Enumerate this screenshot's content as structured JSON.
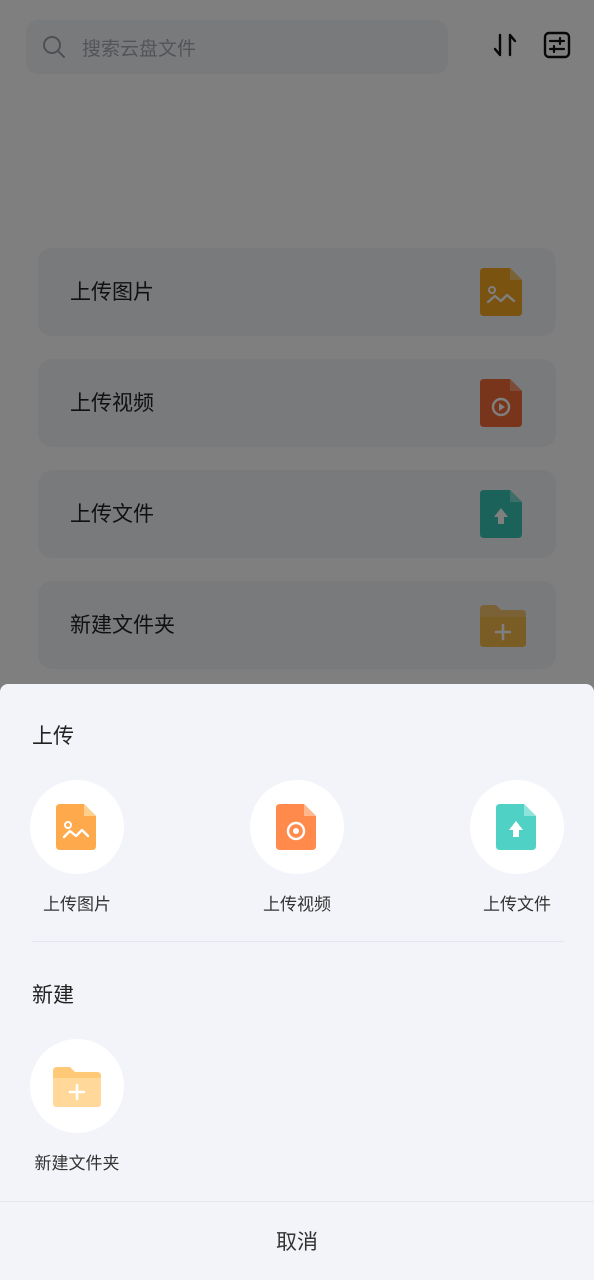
{
  "search": {
    "placeholder": "搜索云盘文件",
    "search_icon": "search-icon"
  },
  "toolbar": {
    "sort_icon": "sort-arrows-icon",
    "filter_icon": "filter-sliders-icon"
  },
  "options": [
    {
      "label": "上传图片",
      "icon": "image-file-icon",
      "color": "#f5a623"
    },
    {
      "label": "上传视频",
      "icon": "video-file-icon",
      "color": "#f26b36"
    },
    {
      "label": "上传文件",
      "icon": "upload-file-icon",
      "color": "#36c7b5"
    },
    {
      "label": "新建文件夹",
      "icon": "folder-plus-icon",
      "color": "#f7c46c"
    }
  ],
  "sheet": {
    "upload_title": "上传",
    "upload_actions": [
      {
        "label": "上传图片",
        "icon": "image-file-icon",
        "color": "#ffa94d"
      },
      {
        "label": "上传视频",
        "icon": "video-file-icon",
        "color": "#ff8a4c"
      },
      {
        "label": "上传文件",
        "icon": "upload-file-icon",
        "color": "#4fd1c5"
      }
    ],
    "new_title": "新建",
    "new_actions": [
      {
        "label": "新建文件夹",
        "icon": "folder-plus-icon",
        "color": "#ffc978"
      }
    ],
    "cancel_label": "取消"
  }
}
